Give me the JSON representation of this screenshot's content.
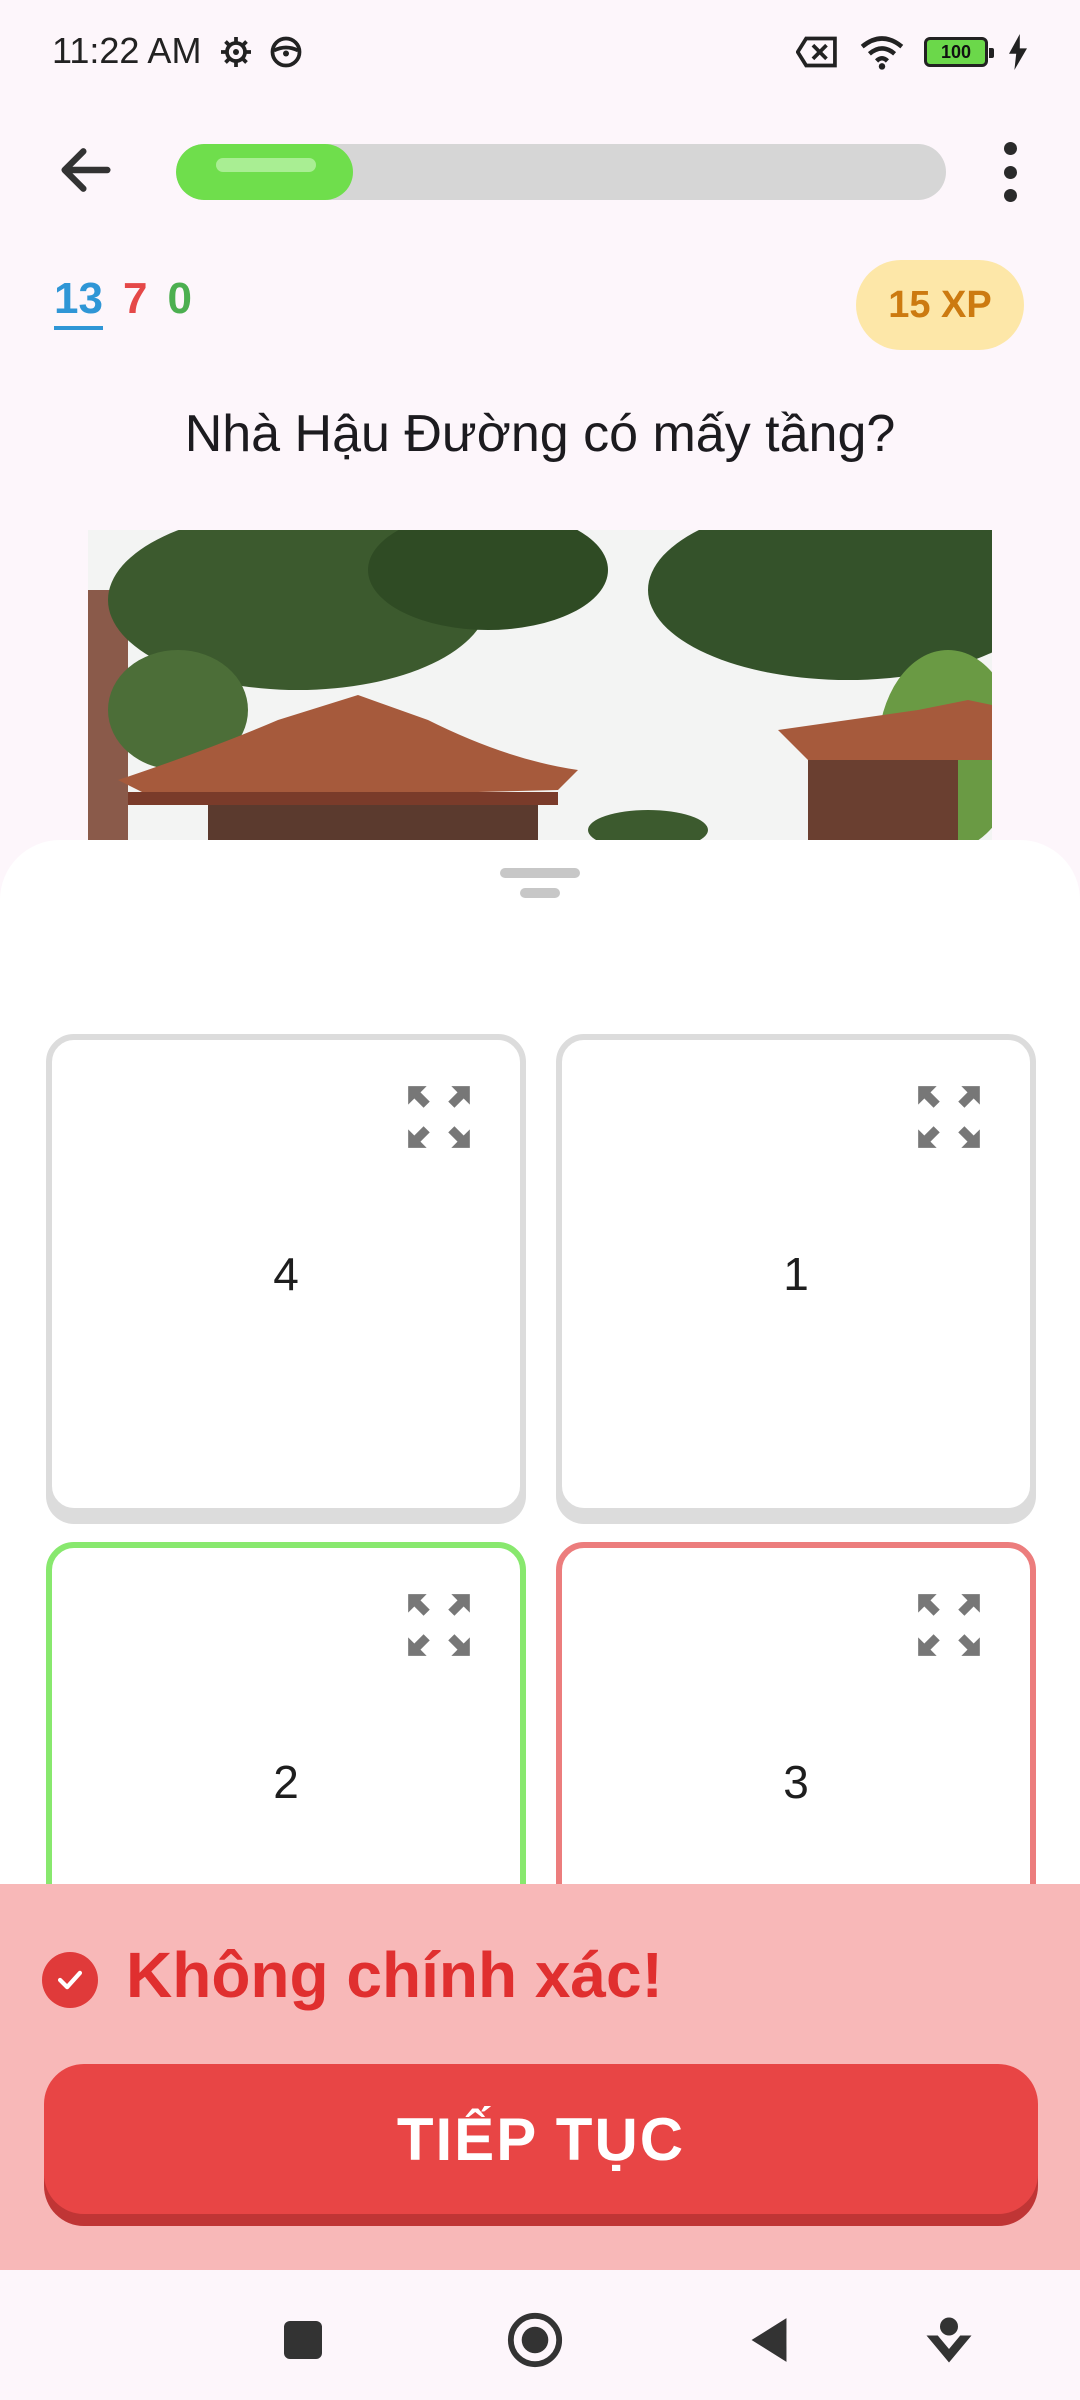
{
  "status_bar": {
    "time": "11:22 AM",
    "battery": "100",
    "icons": [
      "settings-icon",
      "steering-icon",
      "no-sim-icon",
      "wifi-icon",
      "battery-icon",
      "charging-icon"
    ]
  },
  "header": {
    "progress_fraction": 0.23,
    "back_icon": "arrow-left-icon",
    "menu_icon": "more-vertical-icon"
  },
  "scores": {
    "blue": "13",
    "red": "7",
    "green": "0"
  },
  "xp_badge": "15 XP",
  "question": "Nhà Hậu Đường có mấy tầng?",
  "options": [
    {
      "label": "4",
      "state": "neutral"
    },
    {
      "label": "1",
      "state": "neutral"
    },
    {
      "label": "2",
      "state": "correct"
    },
    {
      "label": "3",
      "state": "wrong"
    }
  ],
  "feedback": {
    "message": "Không chính xác!",
    "button_label": "TIẾP TỤC"
  },
  "colors": {
    "progress": "#6fde4c",
    "correct": "#88e86e",
    "wrong": "#ec7d7d",
    "feedback_bg": "#f8b8b8",
    "button": "#e84545",
    "xp_bg": "#fde7a8"
  },
  "nav_bar": {
    "items": [
      "recents-square-icon",
      "home-circle-icon",
      "back-triangle-icon",
      "assist-icon"
    ]
  }
}
